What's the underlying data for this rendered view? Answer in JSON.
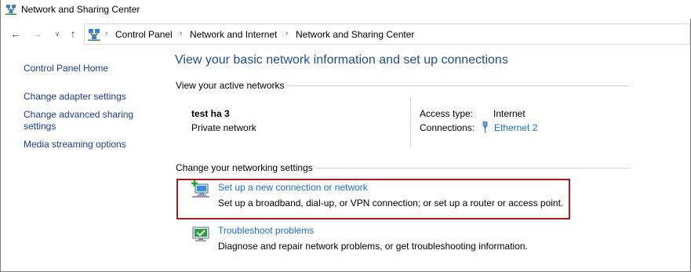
{
  "window": {
    "title": "Network and Sharing Center",
    "icon": "network-center-icon"
  },
  "navigation": {
    "back_icon": "back-arrow-icon",
    "forward_icon": "forward-arrow-icon",
    "recent_icon": "chevron-down-icon",
    "up_icon": "up-arrow-icon",
    "breadcrumb": [
      "Control Panel",
      "Network and Internet",
      "Network and Sharing Center"
    ]
  },
  "sidebar": {
    "items": [
      {
        "label": "Control Panel Home"
      },
      {
        "label": "Change adapter settings"
      },
      {
        "label": "Change advanced sharing settings",
        "line1": "Change advanced sharing",
        "line2": "settings"
      },
      {
        "label": "Media streaming options"
      }
    ]
  },
  "main": {
    "heading": "View your basic network information and set up connections",
    "active_networks_label": "View your active networks",
    "network": {
      "name": "test ha 3",
      "type": "Private network",
      "access_type_label": "Access type:",
      "access_type_value": "Internet",
      "connections_label": "Connections:",
      "connection_link": "Ethernet 2",
      "connection_icon": "ethernet-icon"
    },
    "change_settings_label": "Change your networking settings",
    "tasks": [
      {
        "link": "Set up a new connection or network",
        "description": "Set up a broadband, dial-up, or VPN connection; or set up a router or access point.",
        "icon": "new-connection-icon",
        "highlighted": true
      },
      {
        "link": "Troubleshoot problems",
        "description": "Diagnose and repair network problems, or get troubleshooting information.",
        "icon": "troubleshoot-icon",
        "highlighted": false
      }
    ]
  },
  "colors": {
    "link": "#1a6fc4",
    "sidebar_link": "#1a3d8f",
    "heading": "#1e4e8c",
    "highlight_border": "#a61c1c"
  }
}
